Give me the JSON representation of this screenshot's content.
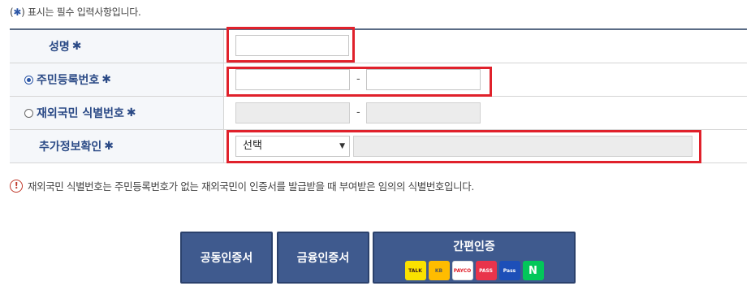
{
  "notice": {
    "prefix": "(",
    "star": "✱",
    "suffix": ") 표시는 필수 입력사항입니다."
  },
  "form": {
    "name_label": "성명",
    "rrn_label": "주민등록번호",
    "foreign_label": "재외국민 식별번호",
    "extra_label": "추가정보확인",
    "required_mark": "✱",
    "dash": "-",
    "select_value": "선택"
  },
  "info": {
    "text": "재외국민 식별번호는 주민등록번호가 없는 재외국민이 인증서를 발급받을 때 부여받은 임의의 식별번호입니다."
  },
  "buttons": {
    "joint_cert": "공동인증서",
    "financial_cert": "금융인증서",
    "easy_cert": "간편인증"
  },
  "logos": {
    "kakao": "TALK",
    "kb": "KB",
    "payco": "PAYCO",
    "pass": "PASS",
    "samsung": "Pass",
    "naver": "N"
  }
}
